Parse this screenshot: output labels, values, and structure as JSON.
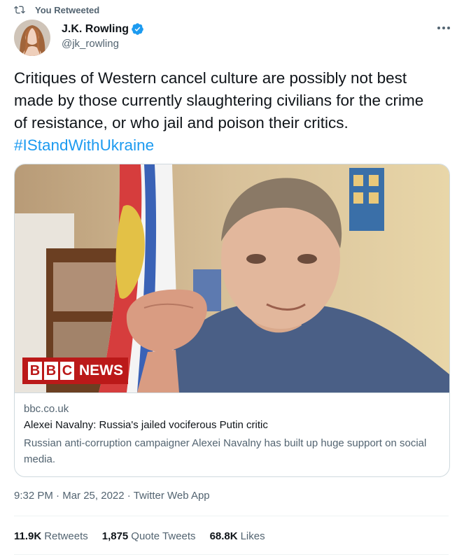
{
  "retweet": {
    "label": "You Retweeted",
    "icon": "retweet-icon"
  },
  "author": {
    "name": "J.K. Rowling",
    "handle": "@jk_rowling",
    "verified": true
  },
  "tweet": {
    "text": "Critiques of Western cancel culture are possibly not best made by those currently slaughtering civilians for the crime of resistance, or who jail and poison their critics.",
    "hashtag": "#IStandWithUkraine"
  },
  "card": {
    "logo_box_letters": [
      "B",
      "B",
      "C"
    ],
    "logo_word": "NEWS",
    "domain": "bbc.co.uk",
    "title": "Alexei Navalny: Russia's jailed vociferous Putin critic",
    "description": "Russian anti-corruption campaigner Alexei Navalny has built up huge support on social media."
  },
  "meta": {
    "time": "9:32 PM",
    "date": "Mar 25, 2022",
    "source": "Twitter Web App",
    "sep": "·"
  },
  "stats": {
    "retweets_count": "11.9K",
    "retweets_label": "Retweets",
    "quotes_count": "1,875",
    "quotes_label": "Quote Tweets",
    "likes_count": "68.8K",
    "likes_label": "Likes"
  },
  "colors": {
    "link": "#1d9bf0",
    "muted": "#536471",
    "bbc_red": "#bb1919"
  }
}
